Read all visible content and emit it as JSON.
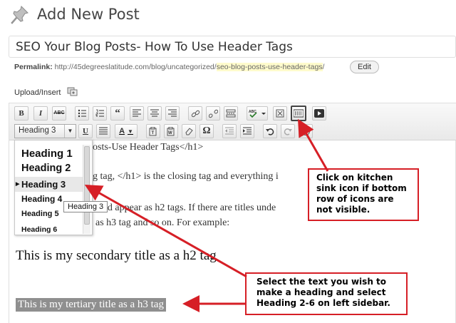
{
  "header": {
    "title": "Add New Post",
    "post_title": "SEO Your Blog Posts- How To Use Header Tags"
  },
  "permalink": {
    "label": "Permalink:",
    "base_url": "http://45degreeslatitude.com/blog/uncategorized/",
    "slug": "seo-blog-posts-use-header-tags",
    "trailing": "/",
    "edit_label": "Edit"
  },
  "upload": {
    "label": "Upload/Insert"
  },
  "toolbar": {
    "row1": [
      "bold",
      "italic",
      "strikethrough",
      "bullet-list",
      "numbered-list",
      "blockquote",
      "align-left",
      "align-center",
      "align-right",
      "link",
      "unlink",
      "more-tag",
      "spellcheck",
      "fullscreen",
      "kitchen-sink",
      "media"
    ],
    "bold_label": "B",
    "italic_label": "I",
    "strike_label": "ABC",
    "quote_label": "“",
    "format_select": "Heading 3",
    "underline_label": "U",
    "color_label": "A",
    "omega_label": "Ω"
  },
  "editor": {
    "line1": "osts-Use Header Tags</h1>",
    "line2": "g tag, </h1> is the closing tag and everything i",
    "line3": "uld appear as h2 tags. If there are titles unde",
    "line4": "as h3 tag and so on.  For example:",
    "h2_text": "This is my secondary title as a h2 tag",
    "h3_text": "This is my tertiary title as a h3 tag"
  },
  "dropdown": {
    "items": [
      "Heading 1",
      "Heading 2",
      "Heading 3",
      "Heading 4",
      "Heading 5",
      "Heading 6"
    ],
    "selected_index": 2,
    "tooltip": "Heading 3"
  },
  "callouts": {
    "kitchen_sink": "Click on kitchen sink icon if bottom row of icons are not visible.",
    "select_heading": "Select the text you wish to make a heading and select Heading 2-6 on left sidebar."
  },
  "colors": {
    "arrow": "#d61f26",
    "selection": "#8f8f8f",
    "slug_highlight": "#fffbcc"
  }
}
